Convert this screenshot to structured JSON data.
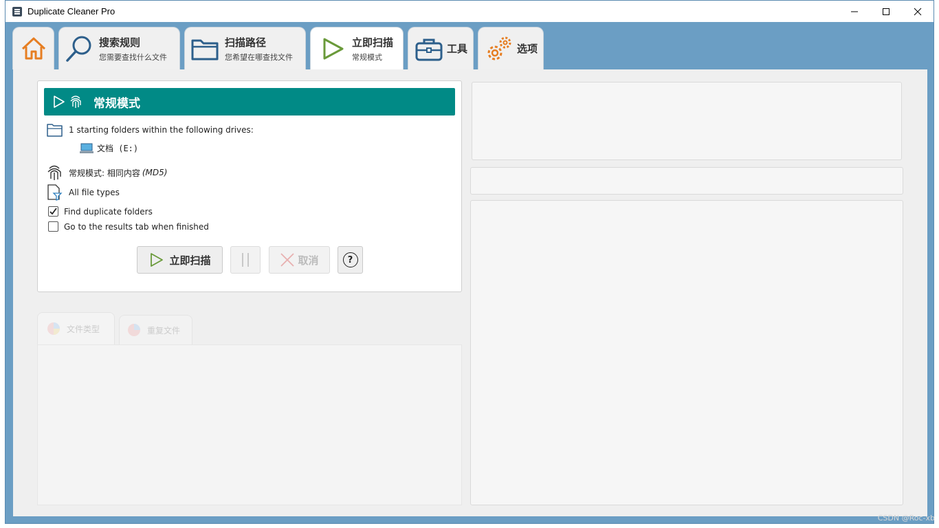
{
  "window": {
    "title": "Duplicate Cleaner Pro"
  },
  "tabs": [
    {
      "id": "home",
      "label": ""
    },
    {
      "id": "search-rules",
      "label": "搜索规则",
      "sub": "您需要查找什么文件"
    },
    {
      "id": "scan-path",
      "label": "扫描路径",
      "sub": "您希望在哪查找文件"
    },
    {
      "id": "scan-now",
      "label": "立即扫描",
      "sub": "常规模式"
    },
    {
      "id": "tools",
      "label": "工具"
    },
    {
      "id": "options",
      "label": "选项"
    }
  ],
  "scan_panel": {
    "mode_title": "常规模式",
    "folders_text": "1 starting folders within the following drives:",
    "drive": "文档 (E:)",
    "method_prefix": "常规模式: 相同内容",
    "method_suffix": "(MD5)",
    "file_types": "All file types",
    "find_dup_folders": {
      "label": "Find duplicate folders",
      "checked": true
    },
    "goto_results": {
      "label": "Go to the results tab when finished",
      "checked": false
    },
    "buttons": {
      "scan": "立即扫描",
      "cancel": "取消",
      "help": "?"
    }
  },
  "chart_tabs": [
    {
      "label": "文件类型"
    },
    {
      "label": "重复文件"
    }
  ],
  "watermark": "CSDN @Roc-xb",
  "colors": {
    "accent_teal": "#018a86",
    "frame_blue": "#6b9ec4",
    "home_orange": "#e67e22",
    "icon_blue": "#2d5f8b",
    "play_green": "#6a9a3a"
  }
}
